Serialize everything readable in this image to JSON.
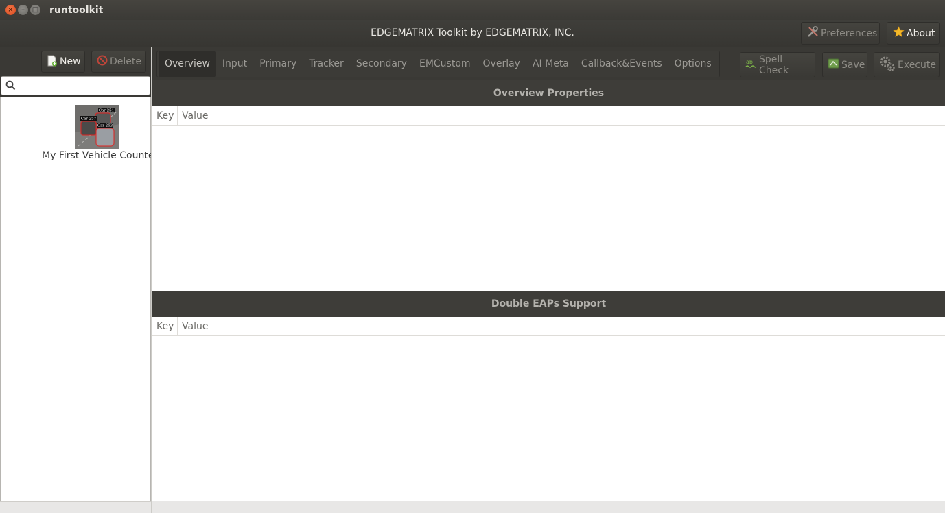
{
  "window": {
    "title": "runtoolkit"
  },
  "header": {
    "app_title": "EDGEMATRIX Toolkit by EDGEMATRIX, INC.",
    "preferences_label": "Preferences",
    "about_label": "About"
  },
  "sidebar": {
    "new_label": "New",
    "delete_label": "Delete",
    "search": {
      "value": "",
      "placeholder": ""
    },
    "projects": [
      {
        "name": "My First Vehicle Counter",
        "thumb_labels": [
          "Car 251",
          "Car 257",
          "Car 263"
        ]
      }
    ]
  },
  "toolbar": {
    "tabs": [
      "Overview",
      "Input",
      "Primary",
      "Tracker",
      "Secondary",
      "EMCustom",
      "Overlay",
      "AI Meta",
      "Callback&Events",
      "Options"
    ],
    "active_tab": "Overview",
    "spell_check_label": "Spell Check",
    "save_label": "Save",
    "execute_label": "Execute"
  },
  "sections": [
    {
      "title": "Overview Properties",
      "columns": [
        "Key",
        "Value"
      ],
      "rows": []
    },
    {
      "title": "Double EAPs Support",
      "columns": [
        "Key",
        "Value"
      ],
      "rows": []
    }
  ],
  "colors": {
    "chrome_dark": "#3a3935",
    "accent_close": "#e0501e",
    "star": "#f4b92a"
  }
}
